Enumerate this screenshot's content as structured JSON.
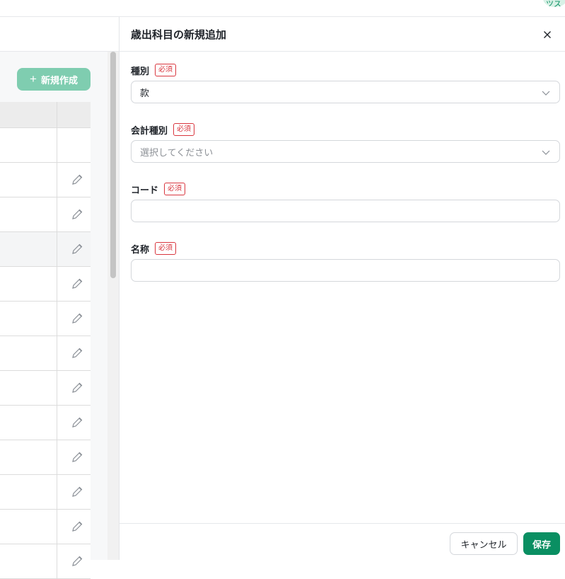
{
  "topbar": {
    "avatar_text": "ツス"
  },
  "background": {
    "new_button_label": "新規作成",
    "new_button_icon": "plus-icon",
    "row_icon": "pencil-icon",
    "row_count": 12
  },
  "drawer": {
    "title": "歳出科目の新規追加",
    "close_icon": "close-icon",
    "required_label": "必須",
    "fields": {
      "type": {
        "label": "種別",
        "value": "款"
      },
      "account_type": {
        "label": "会計種別",
        "placeholder": "選択してください"
      },
      "code": {
        "label": "コード",
        "value": ""
      },
      "name": {
        "label": "名称",
        "value": ""
      }
    },
    "footer": {
      "cancel_label": "キャンセル",
      "save_label": "保存"
    }
  },
  "colors": {
    "primary": "#0a8f62",
    "primary_disabled": "#7fcdb0",
    "required": "#d9363e",
    "border": "#d4d7db"
  }
}
